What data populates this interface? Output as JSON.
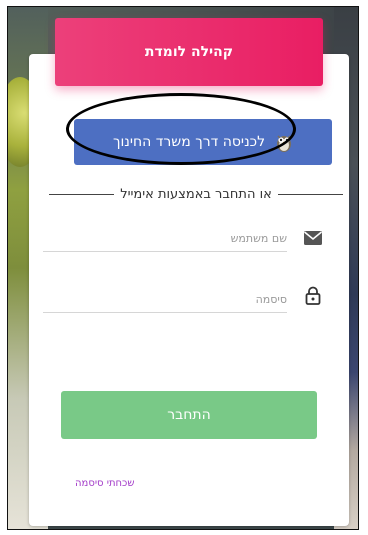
{
  "header": {
    "title": "קהילה לומדת"
  },
  "edu_login": {
    "label": "לכניסה דרך משרד החינוך",
    "icon": "owl-icon",
    "color": "#4d6fc2"
  },
  "divider": {
    "text": "או התחבר באמצעות אימייל"
  },
  "username": {
    "placeholder": "שם משתמש",
    "icon": "envelope-icon"
  },
  "password": {
    "placeholder": "סיסמה",
    "icon": "lock-icon"
  },
  "login_button": {
    "label": "התחבר",
    "color": "#79c987"
  },
  "forgot_password": {
    "label": "שכחתי סיסמה"
  },
  "colors": {
    "header": "#e91e63",
    "link": "#a23ac8"
  }
}
